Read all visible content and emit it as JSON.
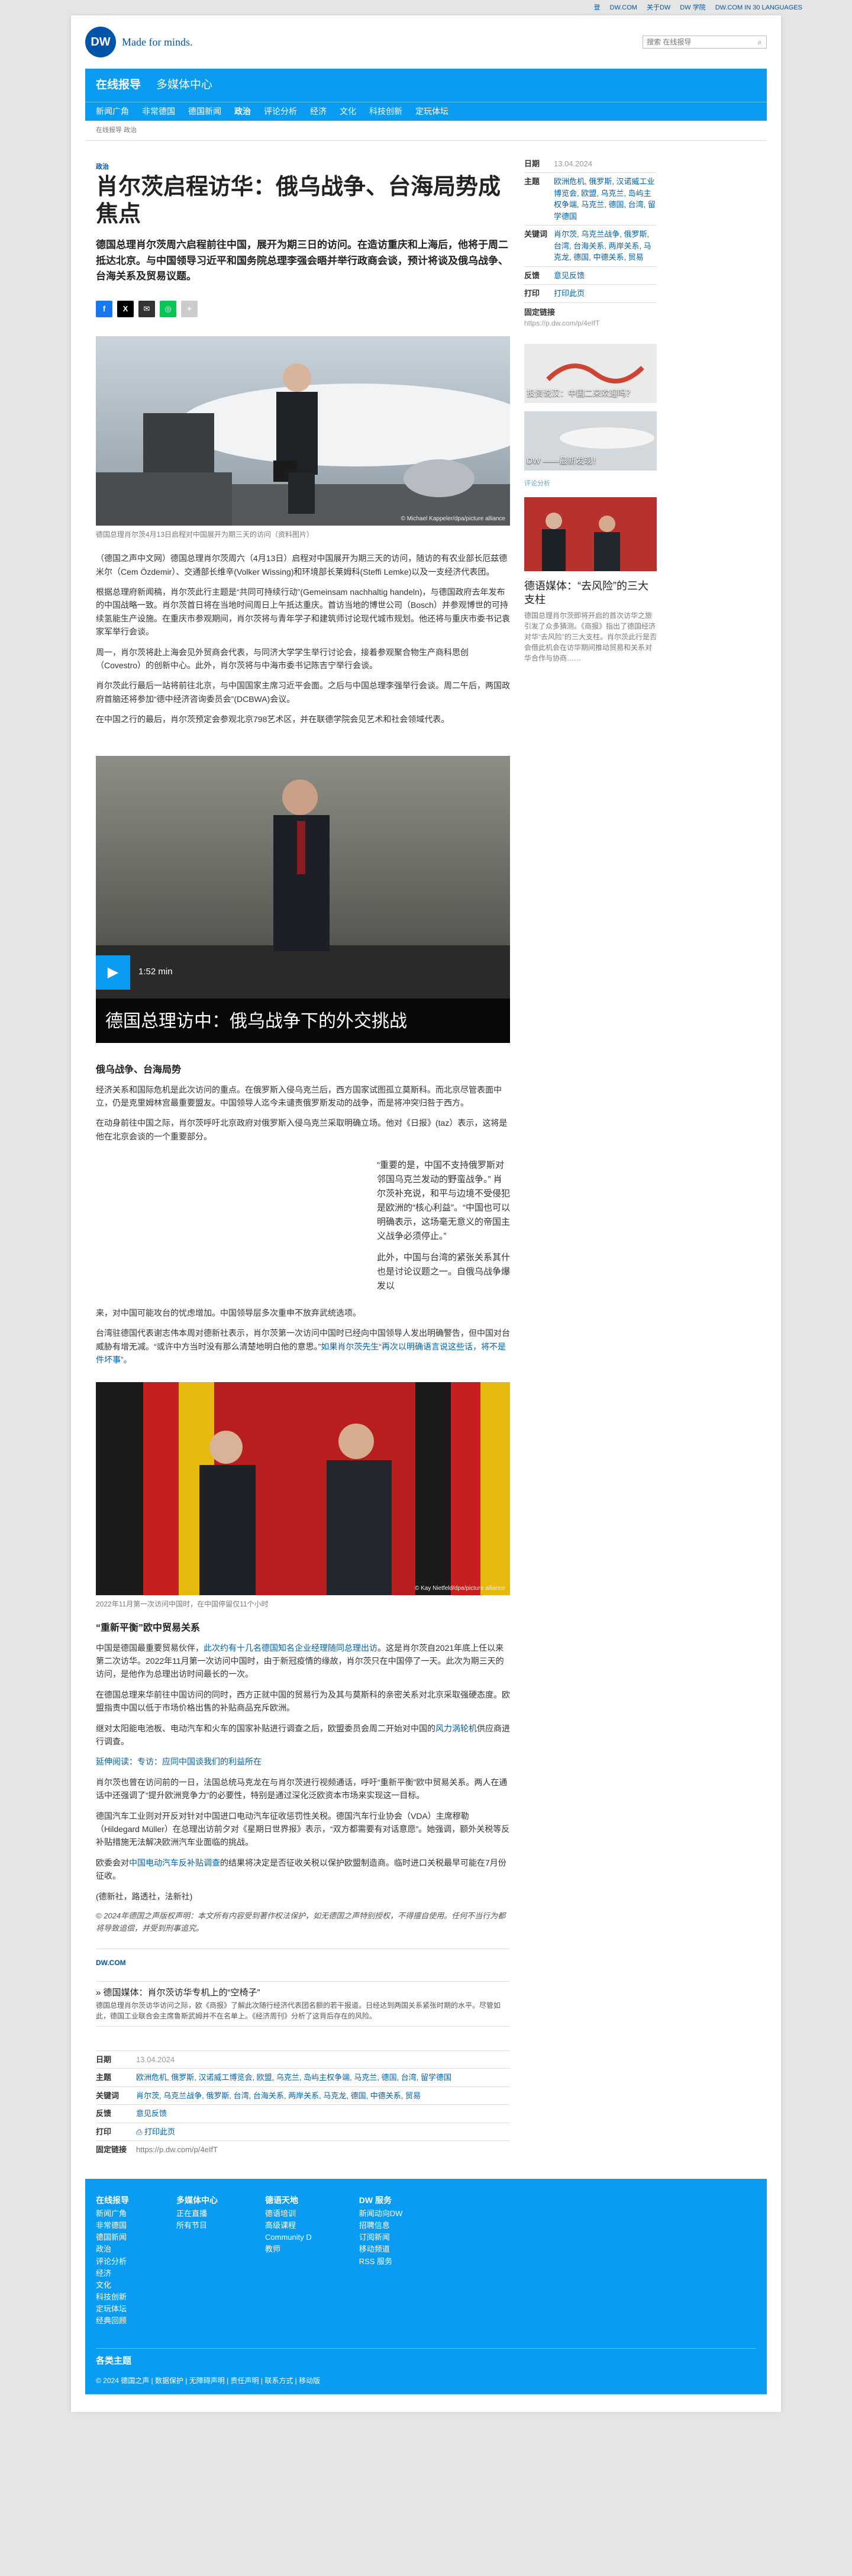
{
  "topbar": [
    "登",
    "DW.COM",
    "关于DW",
    "DW 学院",
    "DW.COM IN 30 LANGUAGES"
  ],
  "header": {
    "logo": "DW",
    "tagline": "Made for minds.",
    "search_placeholder": "搜索 在线报导"
  },
  "nav1": [
    "在线报导",
    "多媒体中心"
  ],
  "nav2": [
    "新闻广角",
    "非常德国",
    "德国新闻",
    "政治",
    "评论分析",
    "经济",
    "文化",
    "科技创新",
    "定玩体坛"
  ],
  "breadcrumb": "在线报导  政治",
  "article": {
    "kicker": "政治",
    "title": "肖尔茨启程访华：俄乌战争、台海局势成焦点",
    "lead": "德国总理肖尔茨周六启程前往中国，展开为期三日的访问。在造访重庆和上海后，他将于周二抵达北京。与中国领导习近平和国务院总理李强会晤并举行政商会谈，预计将谈及俄乌战争、台海关系及贸易议题。",
    "share": [
      "f",
      "X",
      "✉",
      "◎",
      "+"
    ],
    "img1_cap": "德国总理肖尔茨4月13日启程对中国展开为期三天的访问（资料图片）",
    "img1_copy": "© Michael Kappeler/dpa/picture alliance",
    "paras1": [
      "（德国之声中文网）德国总理肖尔茨周六（4月13日）启程对中国展开为期三天的访问，随访的有农业部长厄兹德米尔（Cem Özdemir）、交通部长维辛(Volker Wissing)和环境部长莱姆科(Steffi Lemke)以及一支经济代表团。",
      "根据总理府新闻稿，肖尔茨此行主题是“共同可持续行动”(Gemeinsam nachhaltig handeln)，与德国政府去年发布的中国战略一致。肖尔茨首日将在当地时间周日上午抵达重庆。首访当地的博世公司（Bosch）并参观博世的可持续氢能生产设施。在重庆市参观期间，肖尔茨将与青年学子和建筑师讨论现代城市规划。他还将与重庆市委书记袁家军举行会谈。",
      "周一，肖尔茨将赴上海会见外贸商会代表，与同济大学学生举行讨论会，接着参观聚合物生产商科思创（Covestro）的创新中心。此外，肖尔茨将与中海市委书记陈吉宁举行会谈。",
      "肖尔茨此行最后一站将前往北京，与中国国家主席习近平会面。之后与中国总理李强举行会谈。周二午后，两国政府首脑还将参加“德中经济咨询委员会”(DCBWA)会议。",
      "在中国之行的最后，肖尔茨预定会参观北京798艺术区，并在联德学院会见艺术和社会领域代表。"
    ],
    "video_time": "1:52 min",
    "video_title": "德国总理访中：俄乌战争下的外交挑战",
    "h_ru": "俄乌战争、台海局势",
    "paras2": [
      "经济关系和国际危机是此次访问的重点。在俄罗斯入侵乌克兰后，西方国家试图孤立莫斯科。而北京尽管表面中立，仍是克里姆林宫最重要盟友。中国领导人迄今未谴责俄罗斯发动的战争，而是将冲突归咎于西方。",
      "在动身前往中国之际，肖尔茨呼吁北京政府对俄罗斯入侵乌克兰采取明确立场。他对《日报》(taz）表示，这将是他在北京会谈的一个重要部分。"
    ],
    "quote": [
      "“重要的是，中国不支持俄罗斯对邻国乌克兰发动的野蛮战争。” 肖尔茨补充说，和平与边境不受侵犯是欧洲的“核心利益”。“中国也可以明确表示，这场毫无意义的帝国主义战争必须停止。”",
      "此外，中国与台湾的紧张关系其什也是讨论议题之一。自俄乌战争爆发以"
    ],
    "quote_tail": "来，对中国可能攻台的忧虑增加。中国领导层多次重申不放弃武统选项。",
    "para_tw": "台湾驻德国代表谢志伟本周对德新社表示，肖尔茨第一次访问中国时已经向中国领导人发出明确警告，但中国对台威胁有增无减。“或许中方当时没有那么清楚地明白他的意思。”",
    "para_tw_link": "如果肖尔茨先生“再次以明确语言说这些话，将不是件坏事”。",
    "img2_cap": "2022年11月第一次访问中国时，在中国停留仅11个小时",
    "img2_copy": "© Kay Nietfeld/dpa/picture alliance",
    "h_trade": "“重新平衡”欧中贸易关系",
    "p_trade1a": "中国是德国最重要贸易伙伴，",
    "p_trade1_link": "此次约有十几名德国知名企业经理随同总理出访",
    "p_trade1b": "。这是肖尔茨自2021年底上任以来第二次访华。2022年11月第一次访问中国时，由于新冠疫情的缘故，肖尔茨只在中国停了一天。此次为期三天的访问，是他作为总理出访时间最长的一次。",
    "p_trade2": "在德国总理来华前往中国访问的同时，西方正就中国的贸易行为及其与莫斯科的亲密关系对北京采取强硬态度。欧盟指责中国以低于市场价格出售的补贴商品充斥欧洲。",
    "p_trade3a": "继对太阳能电池板、电动汽车和火车的国家补贴进行调查之后，欧盟委员会周二开始对中国的",
    "p_trade3_link": "风力涡轮机",
    "p_trade3b": "供应商进行调查。",
    "rel_link": "延伸阅读：专访：应同中国谈我们的利益所在",
    "p_trade4": "肖尔茨也曾在访问前的一日，法国总统马克龙在与肖尔茨进行视频通话，呼吁“重新平衡”欧中贸易关系。两人在通话中还强调了“提升欧洲竞争力”的必要性，特别是通过深化泛欧资本市场来实现这一目标。",
    "p_trade5": "德国汽车工业则对开反对针对中国进口电动汽车征收惩罚性关税。德国汽车行业协会（VDA）主席穆勒（Hildegard Müller）在总理出访前夕对《星期日世界报》表示，“双方都需要有对话意愿”。她强调，额外关税等反补贴措施无法解决欧洲汽车业面临的挑战。",
    "p_trade6a": "欧委会对",
    "p_trade6_link": "中国电动汽车反补贴调查",
    "p_trade6b": "的结果将决定是否征收关税以保护欧盟制造商。临时进口关税最早可能在7月份征收。",
    "sources": "(德新社，路透社，法新社)",
    "copyright": "© 2024年德国之声版权声明：本文所有内容受到著作权法保护，如无德国之声特别授权，不得擅自使用。任何不当行为都将导致追偿，并受到刑事追究。",
    "dwcom": "DW.COM",
    "rel_box_title": "德国媒体：肖尔茨访华专机上的“空椅子”",
    "rel_box_text": "德国总理肖尔茨访华访问之际，欧《商报》了解此次随行经济代表团名额的若干报道。日经达到两国关系紧张时期的水平。尽管如此，德国工业联合会主席鲁斯武姆并不在名单上。《经济周刊》分析了这背后存在的风险。",
    "meta": {
      "date_l": "日期",
      "date": "13.04.2024",
      "topic_l": "主题",
      "topics": "欧洲危机, 俄罗斯, 汉诺威工博览会, 欧盟, 乌克兰, 岛屿主权争端, 马克兰, 德国, 台湾, 留学德国",
      "kw_l": "关键词",
      "kw": "肖尔茨, 乌克兰战争, 俄罗斯, 台湾, 台海关系, 两岸关系, 马克龙, 德国, 中德关系, 贸易",
      "fb_l": "反馈",
      "fb": "意见反馈",
      "pr_l": "打印",
      "pr": "打印此页",
      "link_l": "固定链接",
      "link": "https://p.dw.com/p/4eIfT"
    }
  },
  "side": {
    "date_l": "日期",
    "date": "13.04.2024",
    "topic_l": "主题",
    "topics": "欧洲危机, 俄罗斯, 汉诺威工业博览会, 欧盟, 乌克兰, 岛屿主权争端, 马克兰, 德国, 台湾, 留学德国",
    "kw_l": "关键词",
    "kw": "肖尔茨, 乌克兰战争, 俄罗斯, 台湾, 台海关系, 两岸关系, 马克龙, 德国, 中德关系, 贸易",
    "fb_l": "反馈",
    "fb": "意见反馈",
    "pr_l": "打印",
    "pr": "打印此页",
    "link_l": "固定链接",
    "link": "https://p.dw.com/p/4eIfT",
    "thumb1": "投资说汉：中国二来欢迎吗？",
    "thumb2": "DW ——最新发现！",
    "more_head": "评论分析",
    "card_title": "德语媒体：“去风险”的三大支柱",
    "card_text": "德国总理肖尔茨即将开启的首次访华之旅引发了众多猜测。《商报》指出了德国经济对华“去风险”的三大支柱。肖尔茨此行是否会借此机会在访华期间推动贸易和关系对华合作与协商……"
  },
  "footer": {
    "cols": [
      {
        "h": "在线报导",
        "items": [
          "新闻广角",
          "非常德国",
          "德国新闻",
          "政治",
          "评论分析",
          "经济",
          "文化",
          "科技创新",
          "定玩体坛",
          "经典回顾"
        ]
      },
      {
        "h": "多媒体中心",
        "items": [
          "正在直播",
          "所有节目"
        ]
      },
      {
        "h": "德语天地",
        "items": [
          "德语培训",
          "高级课程",
          "Community D",
          "教师"
        ]
      },
      {
        "h": "DW 服务",
        "items": [
          "新闻动向DW",
          "招聘信息",
          "订阅新闻",
          "移动频道",
          "RSS 服务"
        ]
      }
    ],
    "langs": "各类主题",
    "bottom": "© 2024 德国之声 | 数据保护 | 无障碍声明 | 责任声明 | 联系方式 | 移动版"
  }
}
